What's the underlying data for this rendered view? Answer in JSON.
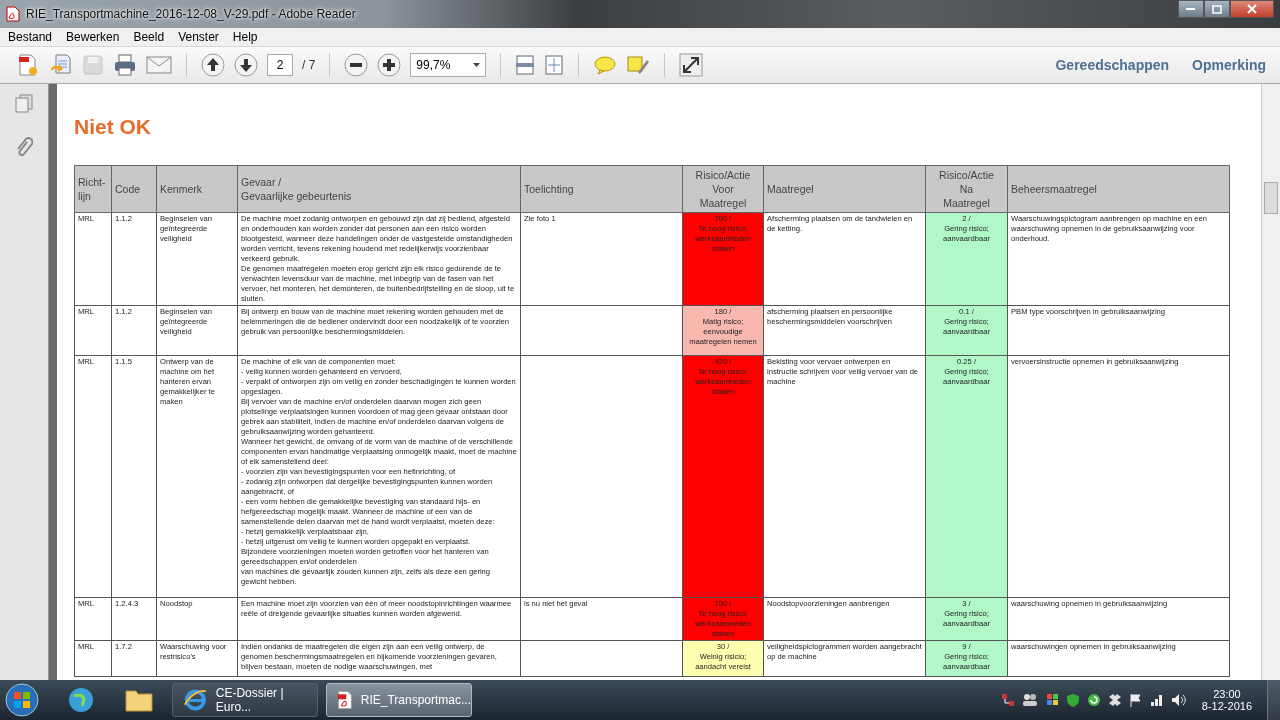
{
  "window": {
    "title": "RIE_Transportmachine_2016-12-08_V-29.pdf - Adobe Reader"
  },
  "menu": [
    "Bestand",
    "Bewerken",
    "Beeld",
    "Venster",
    "Help"
  ],
  "toolbar": {
    "page": "2",
    "page_total": "/ 7",
    "zoom": "99,7%",
    "panels": [
      "Gereedschappen",
      "Opmerking"
    ]
  },
  "document": {
    "heading": "Niet OK",
    "table": {
      "columns": [
        "Richt-\nlijn",
        "Code",
        "Kenmerk",
        "Gevaar /\nGevaarlijke gebeurtenis",
        "Toelichting",
        "Risico/Actie\nVoor\nMaatregel",
        "Maatregel",
        "Risico/Actie\nNa\nMaatregel",
        "Beheersmaatregel"
      ],
      "rows": [
        {
          "richtlijn": "MRL",
          "code": "1.1.2",
          "kenmerk": "Beginselen van geïntegreerde veiligheid",
          "gevaar": "De machine moet zodanig ontworpen en gebouwd zijn dat zij bediend, afgesteld en onderhouden kan worden zonder dat personen aan een risico worden blootgesteld, wanneer deze handelingen onder de vastgestelde omstandigheden worden verricht, tevens rekening houdend met redelijkerwijs voorzienbaar verkeerd gebruik.\nDe genomen maatregelen moeten erop gericht zijn elk risico gedurende de te verwachten levensduur van de machine, met inbegrip van de fasen van het vervoer, het monteren, het demonteren, de buitenbedrijfstelling en de sloop, uit te sluiten.",
          "toelichting": "Zie foto 1",
          "risk_before": {
            "score": "700 /",
            "label": "Te hoog risico; werkzaamheden staken",
            "color": "#ff0000"
          },
          "maatregel": "Afscherming plaatsen om de tandwielen en de ketting.",
          "risk_after": {
            "score": "2 /",
            "label": "Gering risico; aanvaardbaar",
            "color": "#b0f8c8"
          },
          "beheersmaatregel": "Waarschuwingspictogram aanbrengen op machine en een waarschuwing opnemen in de gebruiksaanwijzing voor onderhoud."
        },
        {
          "richtlijn": "MRL",
          "code": "1.1.2",
          "kenmerk": "Beginselen van geïntegreerde veiligheid",
          "gevaar": "Bij ontwerp en bouw van de machine moet rekening worden gehouden met de belemmeringen die de bediener ondervindt door een noodzakelijk of te voorzien gebruik van persoonlijke beschermingsmiddelen.",
          "toelichting": "",
          "risk_before": {
            "score": "180 /",
            "label": "Matig risico; eenvoudige maatregelen nemen",
            "color": "#f8b8b0"
          },
          "maatregel": "afscherming plaatsen en persoonlijke beschermingsmiddelen voorschrijven",
          "risk_after": {
            "score": "0.1 /",
            "label": "Gering risico; aanvaardbaar",
            "color": "#b0f8c8"
          },
          "beheersmaatregel": "PBM type voorschrijven in gebruiksaanwijzing"
        },
        {
          "richtlijn": "MRL",
          "code": "1.1.5",
          "kenmerk": "Ontwerp van de machine om het hanteren ervan gemakkelijker te maken",
          "gevaar": "De machine of elk van de componenten moet:\n- veilig kunnen worden gehanteerd en vervoerd,\n- verpakt of ontworpen zijn om veilig en zonder beschadigingen te kunnen worden opgeslagen.\nBij vervoer van de machine en/of onderdelen daarvan mogen zich geen plotselinge verplaatsingen kunnen voordoen of mag geen gevaar ontstaan door gebrek aan stabiliteit, indien de machine en/of onderdelen daarvan volgens de gebruiksaanwijzing worden gehanteerd.\nWanneer het gewicht, de omvang of de vorm van de machine of de verschillende componenten ervan handmatige verplaatsing onmogelijk maakt, moet de machine of elk samenstellend deel:\n- voorzien zijn van bevestigingspunten voor een hefinrichting, of\n- zodanig zijn ontworpen dat dergelijke bevestigingspunten kunnen worden aangebracht, of\n- een vorm hebben die gemakkelijke bevestiging van standaard hijs- en hefgereedschap mogelijk maakt. Wanneer de machine of een van de samenstellende delen daarvan met de hand wordt verplaatst, moeten deze:\n- hetzij gemakkelijk verplaatsbaar zijn,\n- hetzij uitgerust om veilig te kunnen worden opgepakt en verplaatst.\nBijzondere voorzieningen moeten worden getroffen voor het hanteren van gereedschappen en/of onderdelen\nvan machines die gevaarlijk zouden kunnen zijn, zelfs als deze een gering gewicht hebben.",
          "toelichting": "",
          "risk_before": {
            "score": "420 /",
            "label": "Te hoog risico; werkzaamheden staken",
            "color": "#ff0000"
          },
          "maatregel": "Bekisting voor vervoer ontwerpen en instructie schrijven voor veilig vervoer van de machine",
          "risk_after": {
            "score": "0.25 /",
            "label": "Gering risico; aanvaardbaar",
            "color": "#b0f8c8"
          },
          "beheersmaatregel": "vervoersinstructie opnemen in gebruiksaanwijzing"
        },
        {
          "richtlijn": "MRL",
          "code": "1.2.4.3",
          "kenmerk": "Noodstop",
          "gevaar": "Een machine moet zijn voorzien van één of meer noodstopinrichtingen waarmee reële of dreigende gevaarlijke situaties kunnen worden afgewend.",
          "toelichting": "is nu niet het geval",
          "risk_before": {
            "score": "700 /",
            "label": "Te hoog risico; werkzaamheden staken",
            "color": "#ff0000"
          },
          "maatregel": "Noodstopvoorzieningen aanbrengen",
          "risk_after": {
            "score": "3 /",
            "label": "Gering risico; aanvaardbaar",
            "color": "#b0f8c8"
          },
          "beheersmaatregel": "waarschuwing opnemen in gebruiksaanwijzing"
        },
        {
          "richtlijn": "MRL",
          "code": "1.7.2",
          "kenmerk": "Waarschuwing voor restrisico's",
          "gevaar": "Indien ondanks de maatregelen die eigen zijn aan een veilig ontwerp, de genomen beschermingsmaatregelen en bijkomende voorzieningen gevaren, blijven bestaan, moeten de nodige waarschuwingen, met",
          "toelichting": "",
          "risk_before": {
            "score": "30 /",
            "label": "Weinig risicio; aandacht vereist",
            "color": "#ffffb0"
          },
          "maatregel": "veiligheidspictogrammen worden aangebracht op de machine",
          "risk_after": {
            "score": "9 /",
            "label": "Gering risico; aanvaardbaar",
            "color": "#b0f8c8"
          },
          "beheersmaatregel": "waarschuwingen opnemen in gebruiksaanwijzing"
        }
      ]
    }
  },
  "taskbar": {
    "tasks": [
      {
        "label": "CE-Dossier | Euro...",
        "kind": "browser",
        "selected": false
      },
      {
        "label": "RIE_Transportmac...",
        "kind": "pdf",
        "selected": true
      }
    ],
    "time": "23:00",
    "date": "8-12-2016"
  }
}
